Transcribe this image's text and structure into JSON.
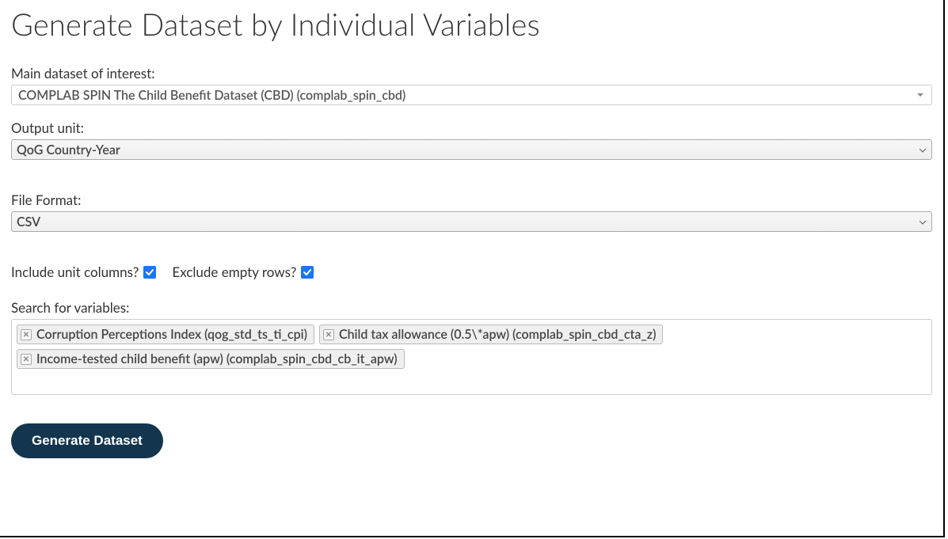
{
  "title": "Generate Dataset by Individual Variables",
  "labels": {
    "main_dataset": "Main dataset of interest:",
    "output_unit": "Output unit:",
    "file_format": "File Format:",
    "include_unit": "Include unit columns?",
    "exclude_empty": "Exclude empty rows?",
    "search_vars": "Search for variables:"
  },
  "values": {
    "main_dataset": "COMPLAB SPIN The Child Benefit Dataset (CBD) (complab_spin_cbd)",
    "output_unit": "QoG Country-Year",
    "file_format": "CSV"
  },
  "checkboxes": {
    "include_unit": true,
    "exclude_empty": true
  },
  "selected_variables": [
    "Corruption Perceptions Index (qog_std_ts_ti_cpi)",
    "Child tax allowance (0.5\\*apw) (complab_spin_cbd_cta_z)",
    "Income-tested child benefit (apw) (complab_spin_cbd_cb_it_apw)"
  ],
  "buttons": {
    "generate": "Generate Dataset"
  }
}
